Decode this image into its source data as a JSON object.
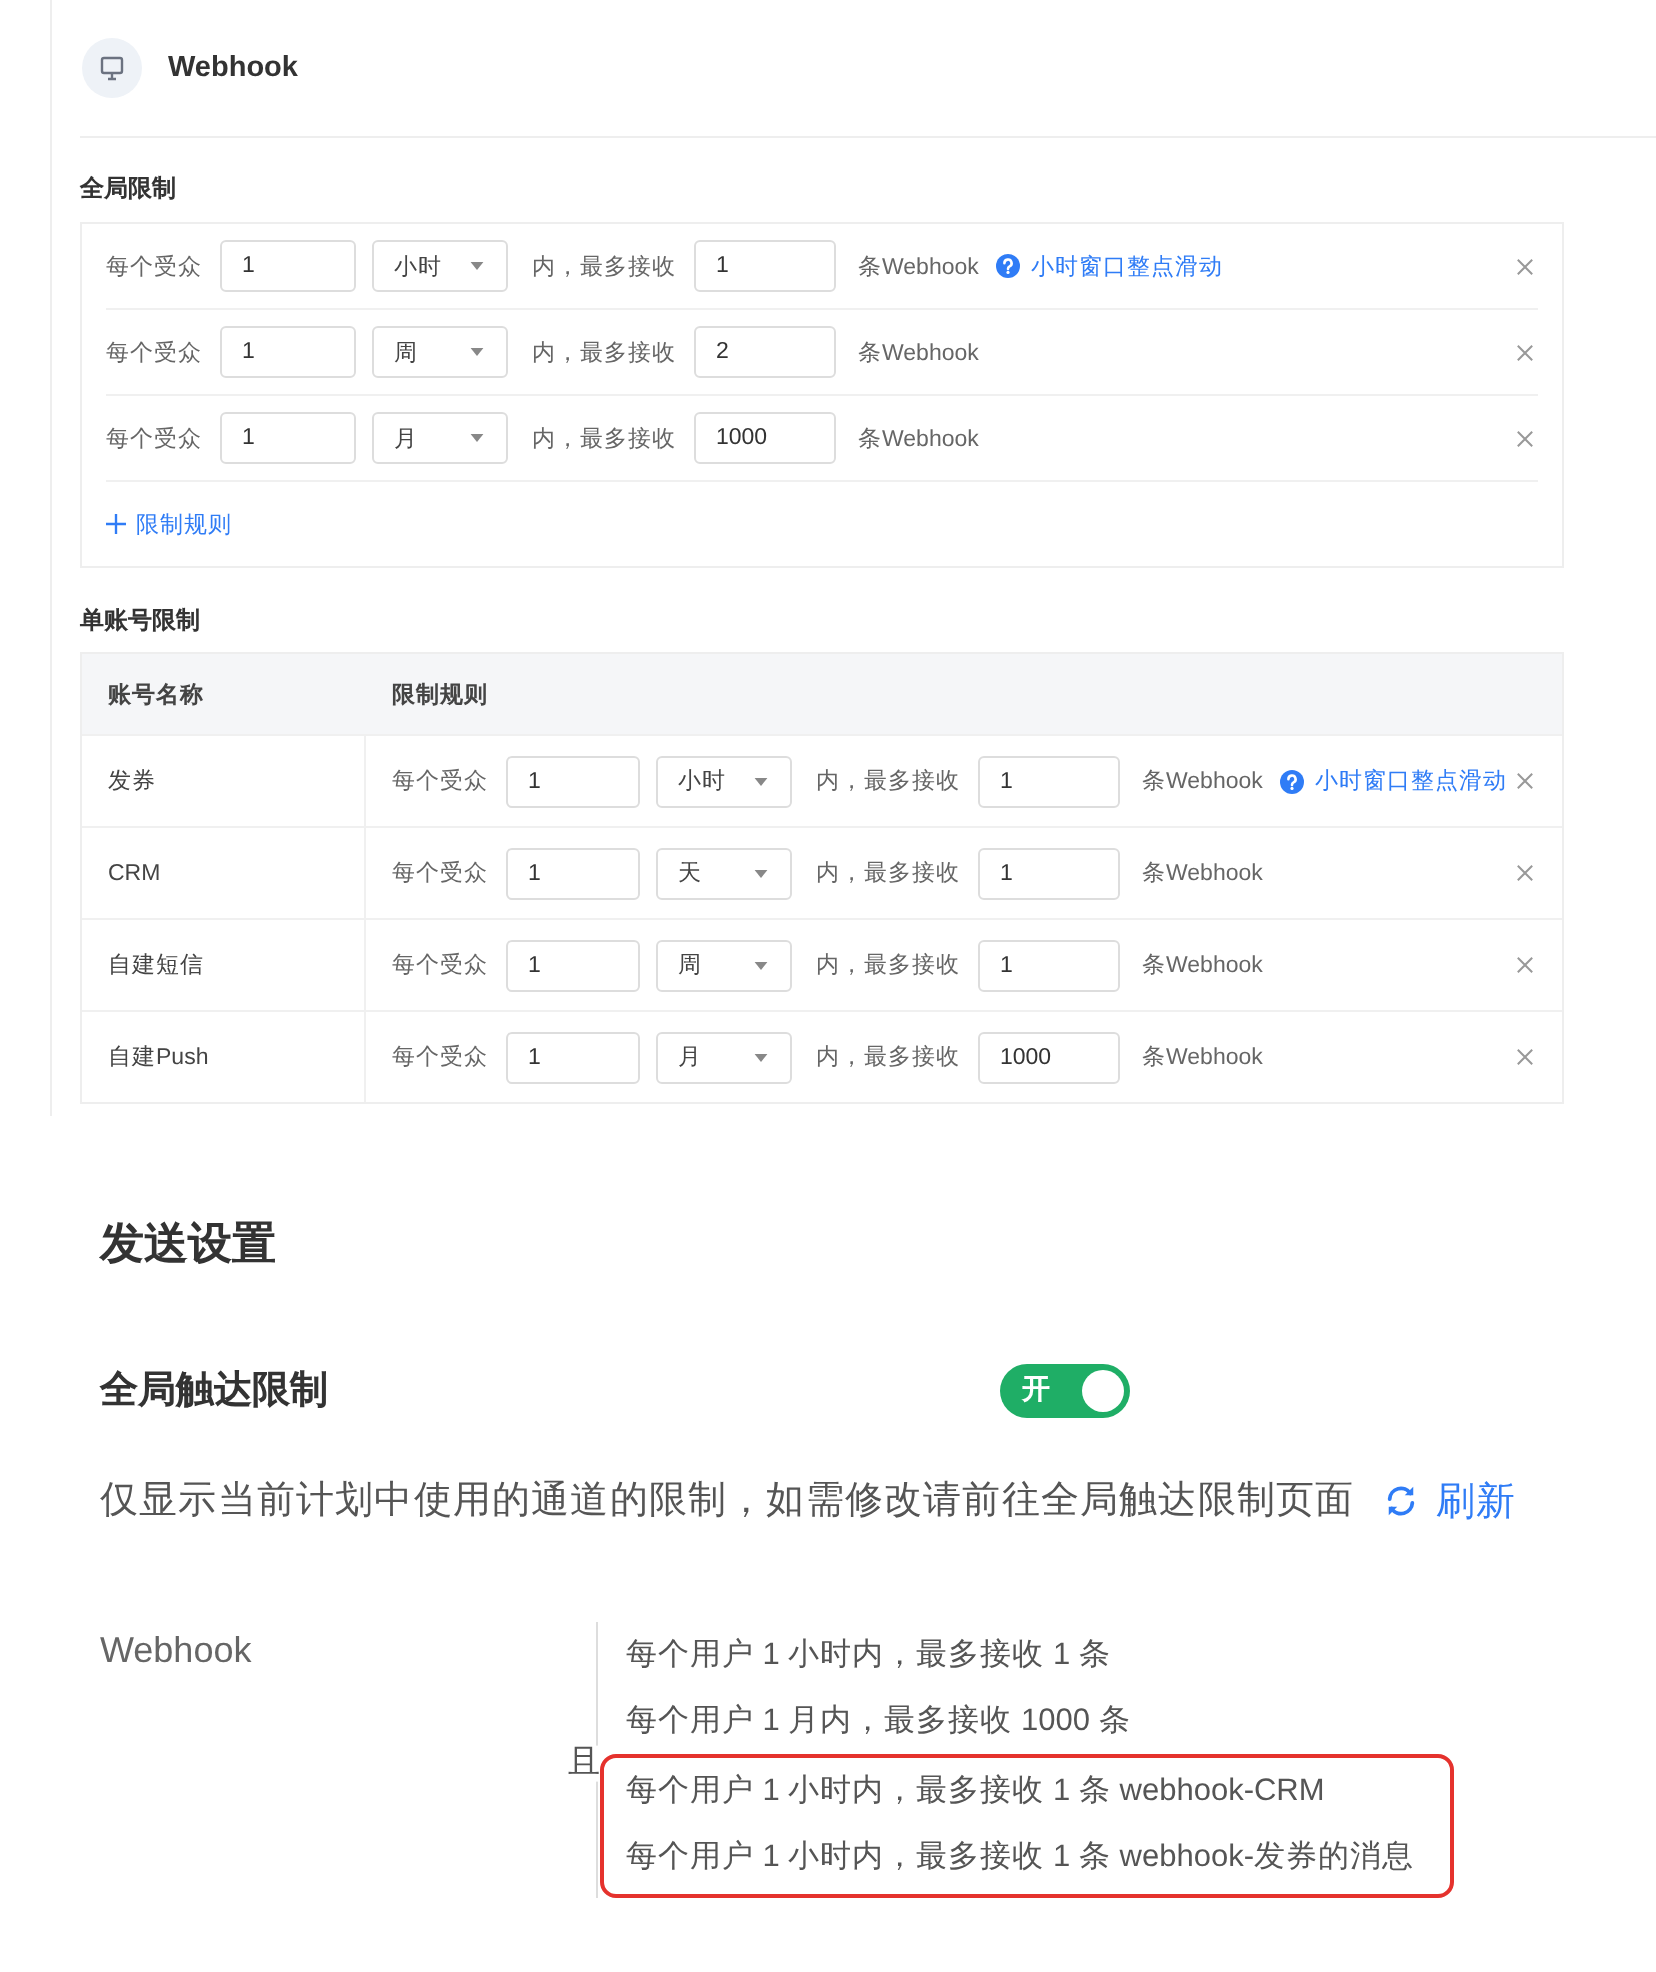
{
  "panel": {
    "title": "Webhook"
  },
  "global_limits": {
    "title": "全局限制",
    "rules": [
      {
        "prefix": "每个受众",
        "count": "1",
        "unit": "小时",
        "middle": "内，最多接收",
        "max": "1",
        "suffix": "条Webhook",
        "hint": "小时窗口整点滑动"
      },
      {
        "prefix": "每个受众",
        "count": "1",
        "unit": "周",
        "middle": "内，最多接收",
        "max": "2",
        "suffix": "条Webhook"
      },
      {
        "prefix": "每个受众",
        "count": "1",
        "unit": "月",
        "middle": "内，最多接收",
        "max": "1000",
        "suffix": "条Webhook"
      }
    ],
    "add_button": "限制规则"
  },
  "account_limits": {
    "title": "单账号限制",
    "columns": [
      "账号名称",
      "限制规则"
    ],
    "rows": [
      {
        "account": "发券",
        "rule": {
          "prefix": "每个受众",
          "count": "1",
          "unit": "小时",
          "middle": "内，最多接收",
          "max": "1",
          "suffix": "条Webhook",
          "hint": "小时窗口整点滑动"
        }
      },
      {
        "account": "CRM",
        "rule": {
          "prefix": "每个受众",
          "count": "1",
          "unit": "天",
          "middle": "内，最多接收",
          "max": "1",
          "suffix": "条Webhook"
        }
      },
      {
        "account": "自建短信",
        "rule": {
          "prefix": "每个受众",
          "count": "1",
          "unit": "周",
          "middle": "内，最多接收",
          "max": "1",
          "suffix": "条Webhook"
        }
      },
      {
        "account": "自建Push",
        "rule": {
          "prefix": "每个受众",
          "count": "1",
          "unit": "月",
          "middle": "内，最多接收",
          "max": "1000",
          "suffix": "条Webhook"
        }
      }
    ]
  },
  "send_settings": {
    "title": "发送设置",
    "reach_limit": {
      "label": "全局触达限制",
      "toggle": {
        "on": true,
        "label": "开"
      }
    },
    "notice": "仅显示当前计划中使用的通道的限制，如需修改请前往全局触达限制页面",
    "refresh": "刷新",
    "channels": [
      {
        "name": "Webhook",
        "joiner": "且",
        "rules": [
          {
            "text": "每个用户 1 小时内，最多接收 1 条",
            "highlighted": false
          },
          {
            "text": "每个用户 1 月内，最多接收 1000 条",
            "highlighted": false
          },
          {
            "text": "每个用户 1 小时内，最多接收 1 条 webhook-CRM",
            "highlighted": true
          },
          {
            "text": "每个用户 1 小时内，最多接收 1 条 webhook-发券的消息",
            "highlighted": true
          }
        ]
      }
    ]
  }
}
